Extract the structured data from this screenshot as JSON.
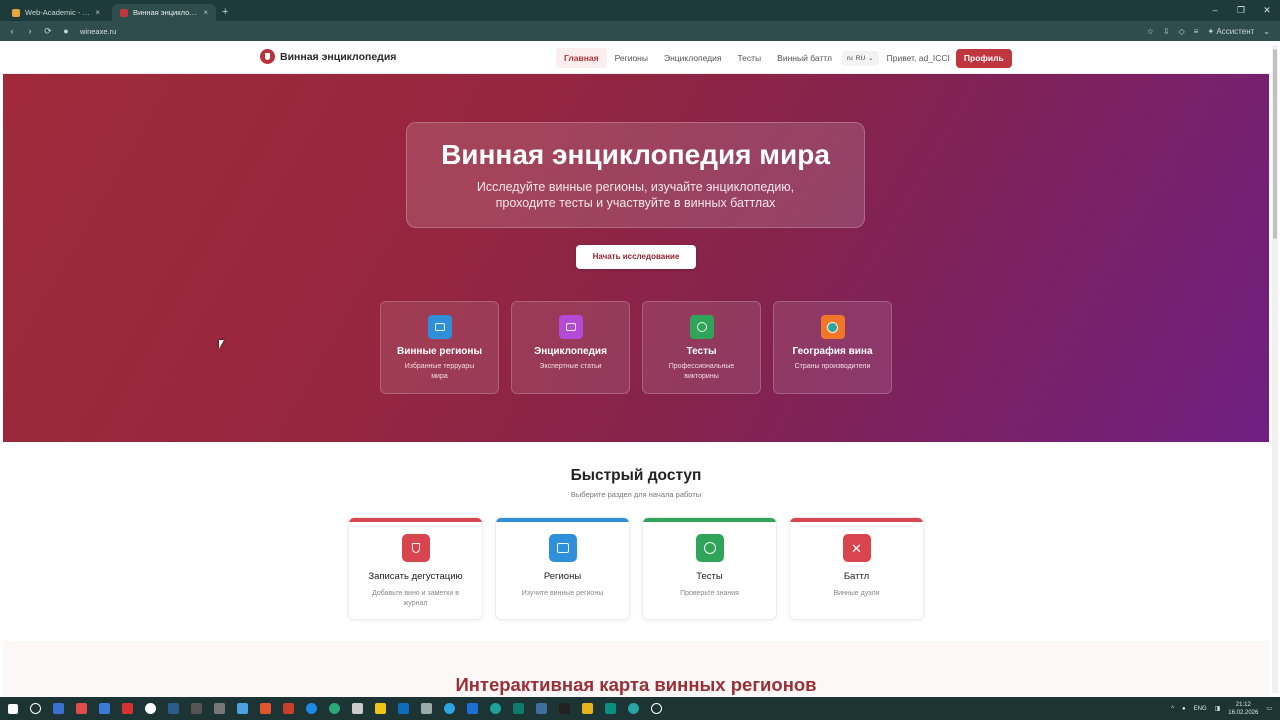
{
  "browser": {
    "tabs": [
      {
        "title": "Web-Academic - Voting P",
        "active": false,
        "icon_color": "#e8a33a"
      },
      {
        "title": "Винная энциклопедия ми",
        "active": true,
        "icon_color": "#c0363e"
      }
    ],
    "new_tab": "+",
    "url": "wineaxe.ru",
    "assistant_label": "Ассистент",
    "window_controls": [
      "–",
      "❐",
      "✕"
    ],
    "nav_icons": [
      "‹",
      "›",
      "⟳"
    ]
  },
  "site": {
    "logo_text": "Винная энциклопедия",
    "nav": [
      {
        "label": "Главная",
        "active": true
      },
      {
        "label": "Регионы",
        "active": false
      },
      {
        "label": "Энциклопедия",
        "active": false
      },
      {
        "label": "Тесты",
        "active": false
      },
      {
        "label": "Винный баттл",
        "active": false
      }
    ],
    "lang_code": "ru",
    "lang_label": "RU",
    "greeting": "Привет, ad_ICCI",
    "profile_button": "Профиль"
  },
  "hero": {
    "title": "Винная энциклопедия мира",
    "subtitle": "Исследуйте винные регионы, изучайте энциклопедию, проходите тесты и участвуйте в винных баттлах",
    "cta": "Начать исследование",
    "features": [
      {
        "title": "Винные регионы",
        "subtitle": "Избранные терруары мира",
        "icon": "book-icon",
        "color": "#2f8fd8"
      },
      {
        "title": "Энциклопедия",
        "subtitle": "Экспертные статьи",
        "icon": "article-icon",
        "color": "#b44ad6"
      },
      {
        "title": "Тесты",
        "subtitle": "Профессиональные викторины",
        "icon": "target-icon",
        "color": "#2fa45a"
      },
      {
        "title": "География вина",
        "subtitle": "Страны производители",
        "icon": "globe-icon",
        "color": "#f0772a"
      }
    ]
  },
  "quick_access": {
    "title": "Быстрый доступ",
    "subtitle": "Выберите раздел для начала работы",
    "cards": [
      {
        "title": "Записать дегустацию",
        "subtitle": "Добавьте вино и заметки в журнал",
        "icon": "wine-glass-icon",
        "color": "#d9454e"
      },
      {
        "title": "Регионы",
        "subtitle": "Изучите винные регионы",
        "icon": "book-icon",
        "color": "#2f8fd8"
      },
      {
        "title": "Тесты",
        "subtitle": "Проверьте знания",
        "icon": "target-icon",
        "color": "#2fa45a"
      },
      {
        "title": "Баттл",
        "subtitle": "Винные дуэли",
        "icon": "swords-icon",
        "color": "#d9454e"
      }
    ]
  },
  "map": {
    "title": "Интерактивная карта винных регионов"
  },
  "taskbar": {
    "language": "ENG",
    "time": "21:12",
    "date": "16.02.2026"
  }
}
